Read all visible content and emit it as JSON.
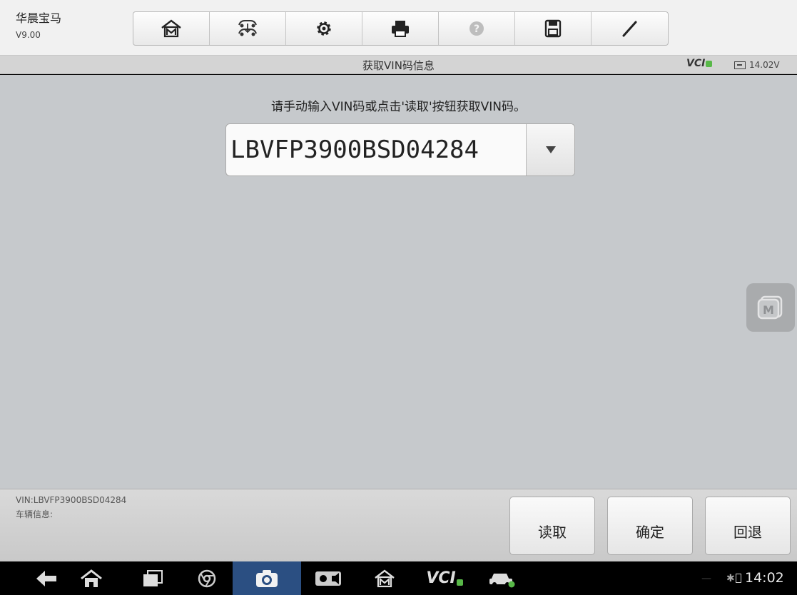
{
  "header": {
    "app_name": "华晨宝马",
    "app_version": "V9.00",
    "toolbar": [
      {
        "name": "home-icon"
      },
      {
        "name": "vehicle-swap-icon"
      },
      {
        "name": "gear-icon"
      },
      {
        "name": "printer-icon"
      },
      {
        "name": "help-icon"
      },
      {
        "name": "save-icon"
      },
      {
        "name": "pen-icon"
      }
    ]
  },
  "titlebar": {
    "title": "获取VIN码信息",
    "vci_label": "VCI",
    "voltage": "14.02V"
  },
  "main": {
    "prompt": "请手动输入VIN码或点击'读取'按钮获取VIN码。",
    "vin_value": "LBVFP3900BSD04284"
  },
  "footer": {
    "vin_info": "VIN:LBVFP3900BSD04284",
    "vehicle_info": "车辆信息:",
    "read_label": "读取",
    "confirm_label": "确定",
    "back_label": "回退"
  },
  "system_nav": {
    "vci_label": "VCI",
    "time": "14:02"
  },
  "colors": {
    "content_bg": "#c6c9cc",
    "vci_ok": "#58b848",
    "nav_active": "#2b4f82"
  }
}
